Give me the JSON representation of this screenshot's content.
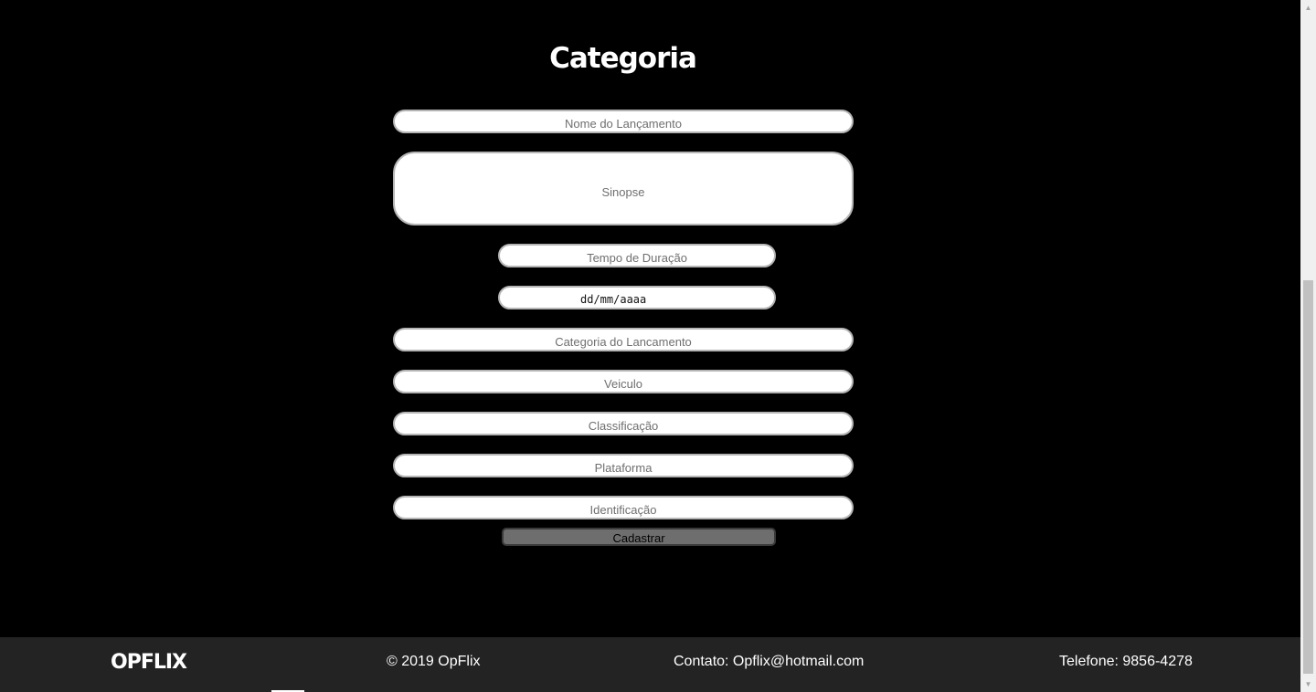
{
  "page": {
    "title": "Categoria"
  },
  "form": {
    "nome_placeholder": "Nome do Lançamento",
    "sinopse_placeholder": "Sinopse",
    "duracao_placeholder": "Tempo de Duração",
    "data_placeholder": "dd/mm/aaaa",
    "categoria_placeholder": "Categoria do Lancamento",
    "veiculo_placeholder": "Veiculo",
    "classificacao_placeholder": "Classificação",
    "plataforma_placeholder": "Plataforma",
    "identificacao_placeholder": "Identificação",
    "submit_label": "Cadastrar"
  },
  "footer": {
    "logo": "OPFLIX",
    "copyright": "© 2019 OpFlix",
    "contact": "Contato: Opflix@hotmail.com",
    "phone": "Telefone: 9856-4278"
  },
  "icons": {
    "scroll_up": "chevron-up-icon",
    "scroll_down": "chevron-down-icon"
  },
  "colors": {
    "background": "#000000",
    "footer": "#232323",
    "button": "#6e6e6e"
  }
}
